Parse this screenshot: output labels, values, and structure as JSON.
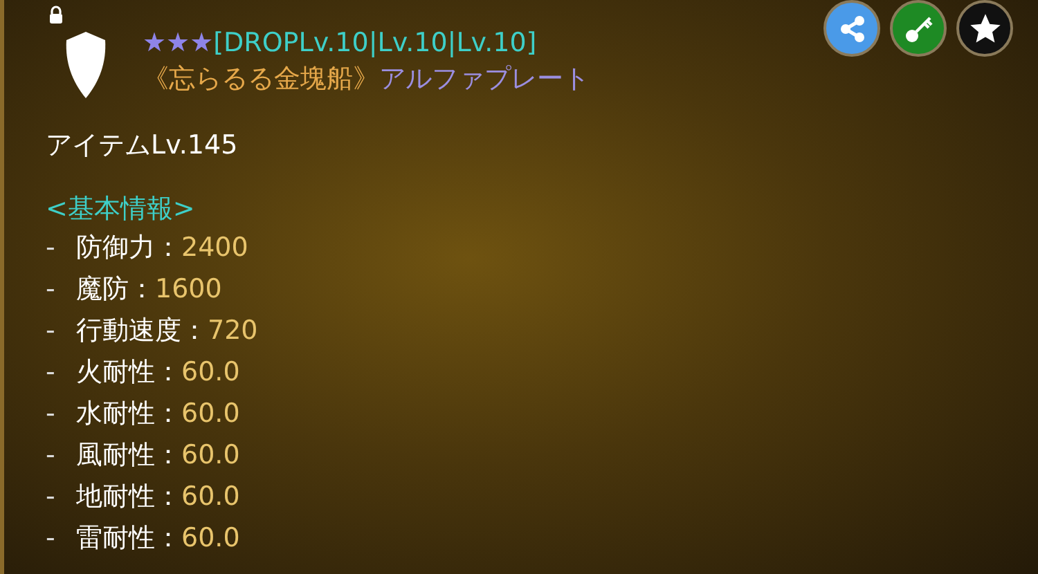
{
  "item": {
    "locked": true,
    "stars": "★★★",
    "tag": "[DROPLv.10|Lv.10|Lv.10]",
    "set_name": "《忘らるる金塊船》",
    "name": "アルファプレート",
    "level": "アイテムLv.145"
  },
  "section": "<基本情報>",
  "stats": [
    {
      "bullet": "-",
      "label": "防御力：",
      "value": "2400"
    },
    {
      "bullet": "-",
      "label": "魔防：",
      "value": "1600"
    },
    {
      "bullet": "-",
      "label": "行動速度：",
      "value": "720"
    },
    {
      "bullet": "-",
      "label": "火耐性：",
      "value": "60.0"
    },
    {
      "bullet": "-",
      "label": "水耐性：",
      "value": "60.0"
    },
    {
      "bullet": "-",
      "label": "風耐性：",
      "value": "60.0"
    },
    {
      "bullet": "-",
      "label": "地耐性：",
      "value": "60.0"
    },
    {
      "bullet": "-",
      "label": "雷耐性：",
      "value": "60.0"
    }
  ]
}
